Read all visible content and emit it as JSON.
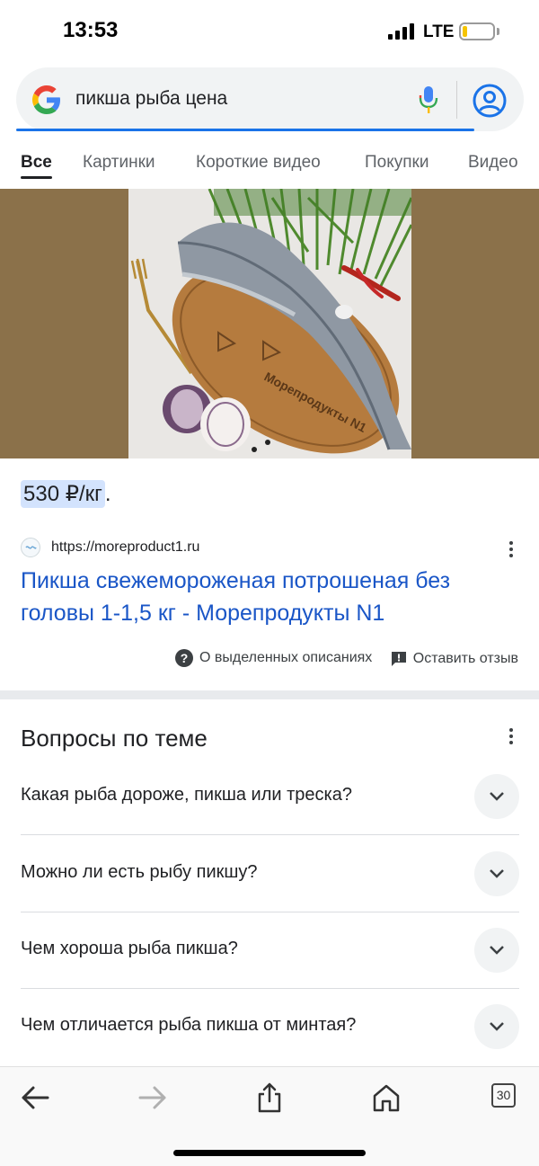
{
  "status_bar": {
    "time": "13:53",
    "network": "LTE",
    "battery_level": 0.15,
    "battery_color": "#f5c400"
  },
  "search": {
    "query": "пикша рыба цена",
    "logo_icon": "google-g-icon",
    "mic_icon": "microphone-icon",
    "account_icon": "account-circle-icon"
  },
  "tabs": [
    {
      "label": "Все",
      "active": true
    },
    {
      "label": "Картинки",
      "active": false
    },
    {
      "label": "Короткие видео",
      "active": false
    },
    {
      "label": "Покупки",
      "active": false
    },
    {
      "label": "Видео",
      "active": false
    }
  ],
  "featured_snippet": {
    "price": "530 ₽/кг",
    "price_suffix": ".",
    "image_caption": "Морепродукты N1",
    "source_url": "https://moreproduct1.ru",
    "title": "Пикша свежемороженая потрошеная без головы 1-1,5 кг - Морепродукты N1",
    "about_label": "О выделенных описаниях",
    "feedback_label": "Оставить отзыв"
  },
  "related_questions": {
    "title": "Вопросы по теме",
    "items": [
      "Какая рыба дороже, пикша или треска?",
      "Можно ли есть рыбу пикшу?",
      "Чем хороша рыба пикша?",
      "Чем отличается рыба пикша от минтая?"
    ]
  },
  "toolbar": {
    "tabs_count": "30",
    "icons": [
      "back-arrow-icon",
      "forward-arrow-icon",
      "share-icon",
      "home-icon",
      "tabs-icon"
    ]
  },
  "colors": {
    "link": "#1a56c7",
    "accent": "#1a73e8",
    "price_highlight": "#d3e3fd"
  }
}
